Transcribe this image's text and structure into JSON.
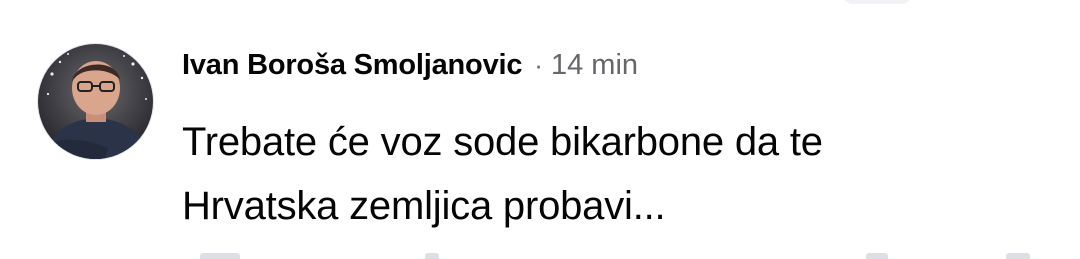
{
  "comment": {
    "author_name": "Ivan Boroša Smoljanovic",
    "separator": "·",
    "timestamp": "14 min",
    "text_lines": [
      "Trebate će voz sode bikarbone da te",
      "Hrvatska zemljica probavi..."
    ],
    "avatar_icon": "profile-photo-avatar"
  },
  "colors": {
    "text_primary": "#050505",
    "text_secondary": "#65676b",
    "background": "#ffffff"
  }
}
